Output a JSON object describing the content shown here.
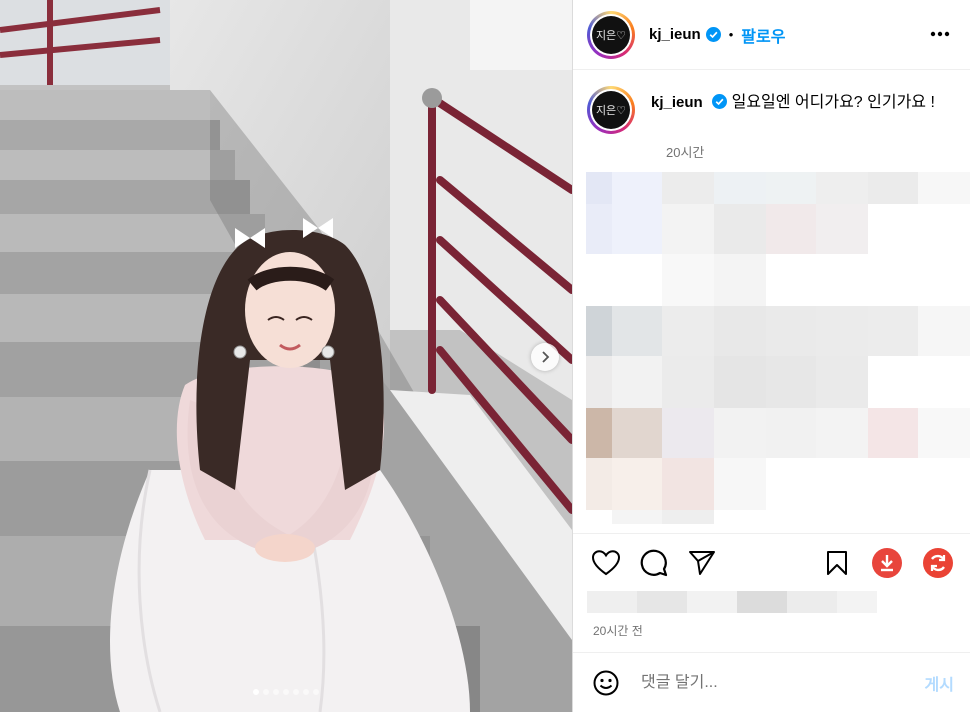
{
  "post": {
    "username": "kj_ieun",
    "avatar_text": "지은♡",
    "follow_label": "팔로우",
    "separator": "•",
    "caption_text": "일요일엔 어디가요? 인기가요 !",
    "caption_time": "20시간",
    "footer_time": "20시간 전",
    "carousel": {
      "total": 7,
      "current": 1
    }
  },
  "comment_box": {
    "placeholder": "댓글 달기...",
    "post_label": "게시"
  },
  "icons": {
    "more": "more-horizontal-icon",
    "like": "heart-icon",
    "comment": "comment-bubble-icon",
    "share": "paper-plane-icon",
    "save": "bookmark-icon",
    "download": "download-icon",
    "refresh": "refresh-icon",
    "emoji": "emoji-icon",
    "next": "chevron-right-icon"
  },
  "colors": {
    "accent": "#0095f6",
    "verified": "#0095f6",
    "download_button": "#e8453c",
    "refresh_button": "#ea4335",
    "muted_text": "#737373"
  }
}
